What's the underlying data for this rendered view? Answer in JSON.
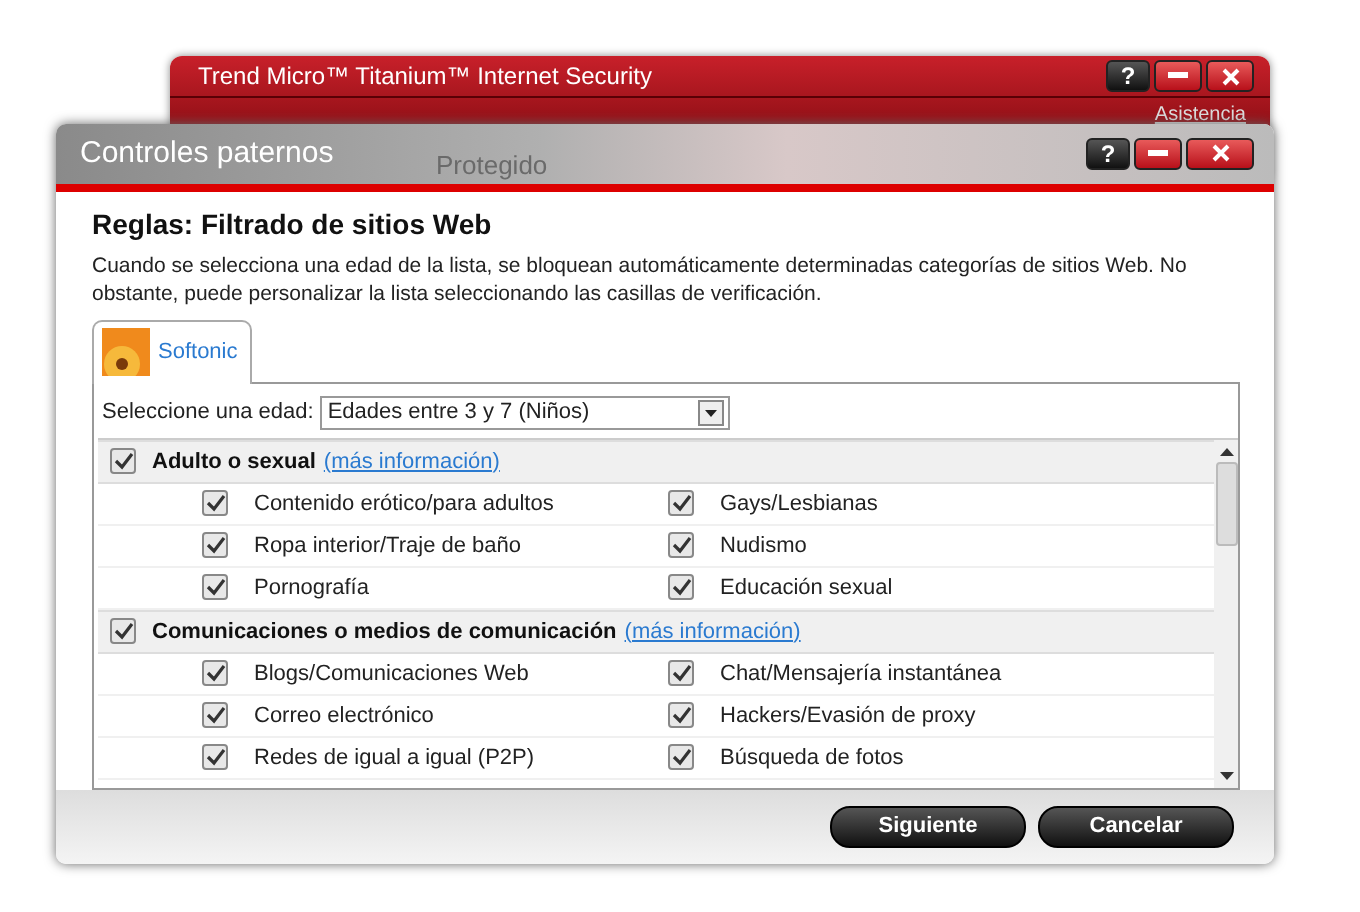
{
  "back_window": {
    "title": "Trend Micro™ Titanium™ Internet Security",
    "help_button": "?",
    "link": "Asistencia",
    "status": "Protegido"
  },
  "window": {
    "title": "Controles paternos",
    "help_button": "?"
  },
  "heading": "Reglas: Filtrado de sitios Web",
  "description": "Cuando se selecciona una edad de la lista, se bloquean automáticamente determinadas categorías de sitios Web. No obstante, puede personalizar la lista seleccionando las casillas de verificación.",
  "tabs": [
    {
      "label": "Softonic",
      "selected": true
    }
  ],
  "age": {
    "label": "Seleccione una edad:",
    "value": "Edades entre 3 y 7 (Niños)"
  },
  "categories": [
    {
      "name": "Adulto o sexual",
      "link": "(más información)",
      "checked": true,
      "items": [
        {
          "label": "Contenido erótico/para adultos",
          "checked": true
        },
        {
          "label": "Gays/Lesbianas",
          "checked": true
        },
        {
          "label": "Ropa interior/Traje de baño",
          "checked": true
        },
        {
          "label": "Nudismo",
          "checked": true
        },
        {
          "label": "Pornografía",
          "checked": true
        },
        {
          "label": "Educación sexual",
          "checked": true
        }
      ]
    },
    {
      "name": "Comunicaciones o medios de comunicación",
      "link": "(más información)",
      "checked": true,
      "items": [
        {
          "label": "Blogs/Comunicaciones Web",
          "checked": true
        },
        {
          "label": "Chat/Mensajería instantánea",
          "checked": true
        },
        {
          "label": "Correo electrónico",
          "checked": true
        },
        {
          "label": "Hackers/Evasión de proxy",
          "checked": true
        },
        {
          "label": "Redes de igual a igual (P2P)",
          "checked": true
        },
        {
          "label": "Búsqueda de fotos",
          "checked": true
        }
      ]
    }
  ],
  "buttons": [
    "Siguiente",
    "Cancelar"
  ]
}
